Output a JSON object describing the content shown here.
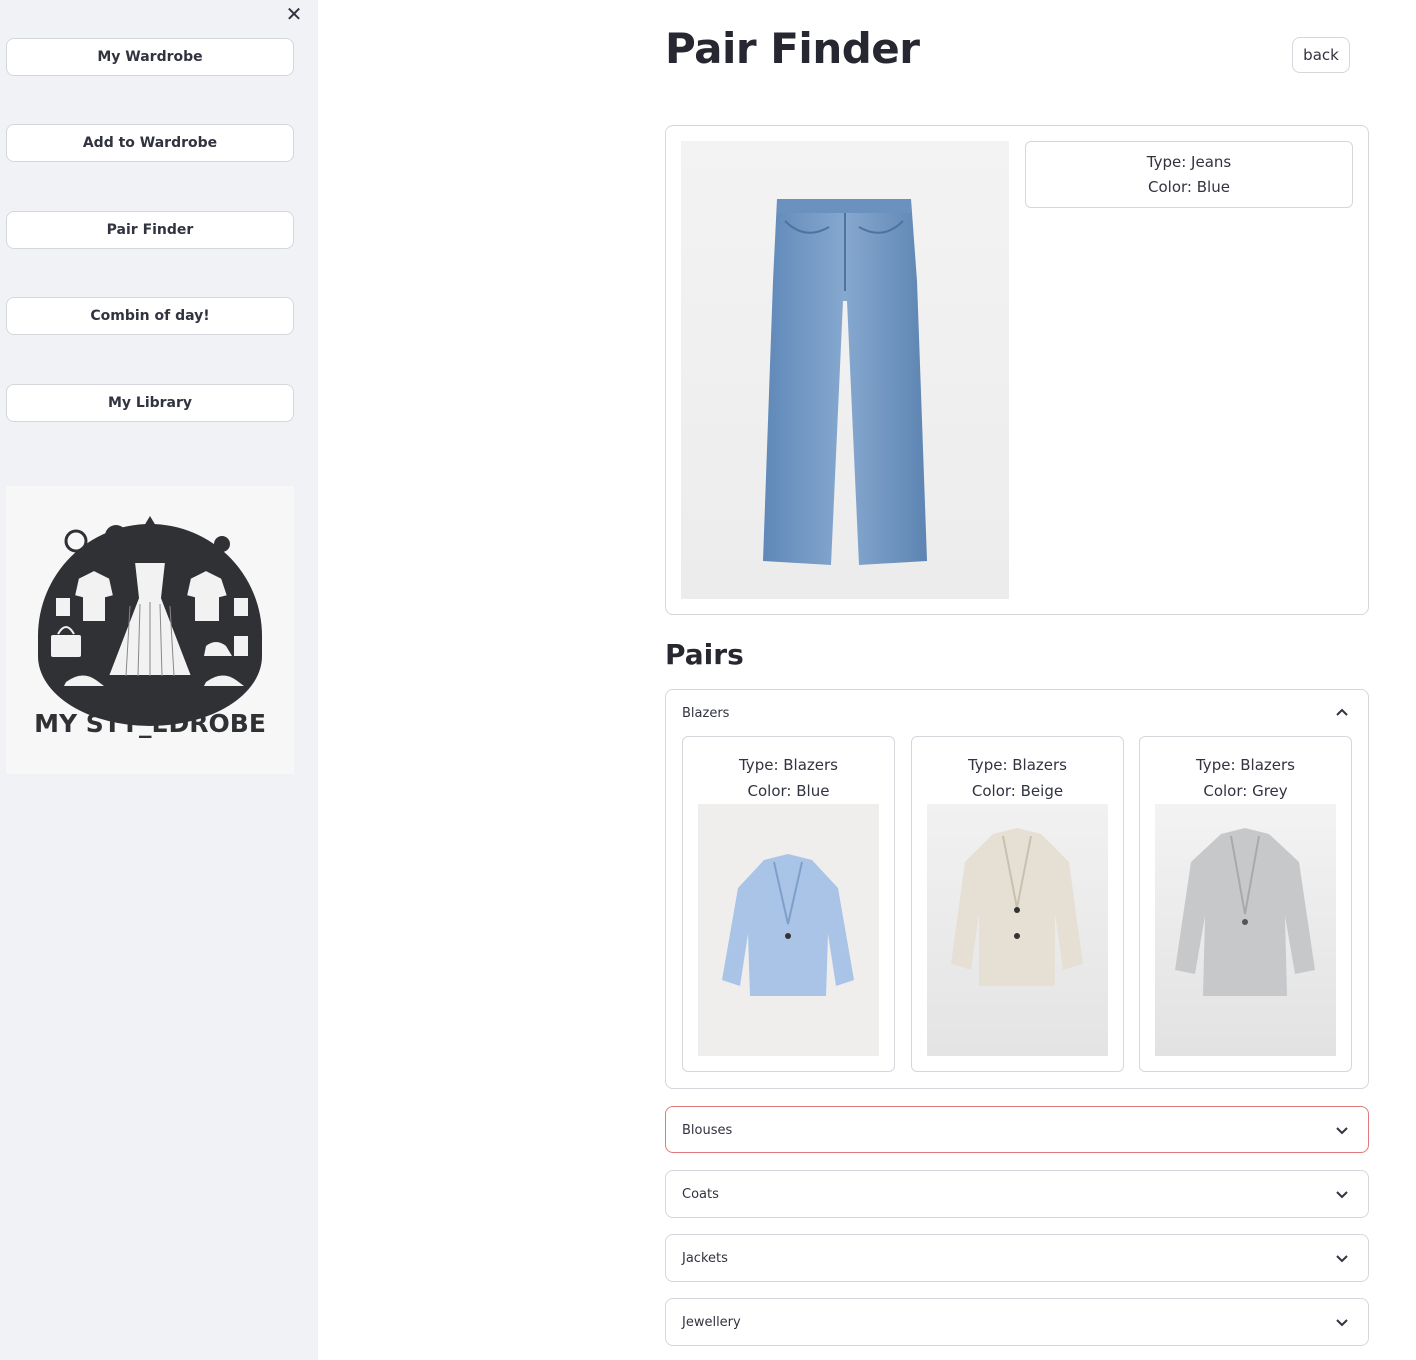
{
  "sidebar": {
    "nav": [
      {
        "label": "My Wardrobe"
      },
      {
        "label": "Add to Wardrobe"
      },
      {
        "label": "Pair Finder"
      },
      {
        "label": "Combin of day!"
      },
      {
        "label": "My Library"
      }
    ],
    "logo_text": "MY STY_EDROBE"
  },
  "header": {
    "title": "Pair Finder",
    "back_label": "back"
  },
  "item": {
    "type_text": "Type: Jeans",
    "color_text": "Color: Blue"
  },
  "pairs": {
    "title": "Pairs",
    "expanders": [
      {
        "label": "Blazers",
        "expanded": true,
        "items": [
          {
            "type_text": "Type: Blazers",
            "color_text": "Color: Blue",
            "swatch": "#a9c4e6"
          },
          {
            "type_text": "Type: Blazers",
            "color_text": "Color: Beige",
            "swatch": "#e6e0d4"
          },
          {
            "type_text": "Type: Blazers",
            "color_text": "Color: Grey",
            "swatch": "#c7c8ca"
          }
        ]
      },
      {
        "label": "Blouses",
        "expanded": false
      },
      {
        "label": "Coats",
        "expanded": false
      },
      {
        "label": "Jackets",
        "expanded": false
      },
      {
        "label": "Jewellery",
        "expanded": false
      }
    ]
  },
  "colors": {
    "focus_border": "#e07b7b",
    "sidebar_bg": "#f0f2f6"
  }
}
